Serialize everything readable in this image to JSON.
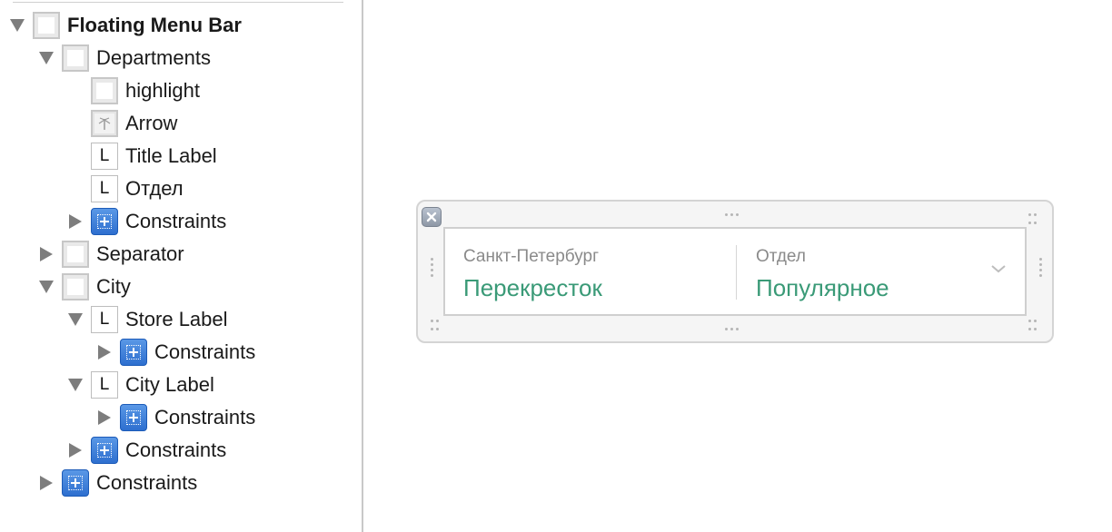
{
  "outline": {
    "rows": [
      {
        "label": "Floating Menu Bar",
        "icon": "view-icon",
        "disclosure": "expanded",
        "level": 0,
        "bold": true
      },
      {
        "label": "Departments",
        "icon": "view-icon",
        "disclosure": "expanded",
        "level": 1,
        "bold": false
      },
      {
        "label": "highlight",
        "icon": "view-icon",
        "disclosure": "none",
        "level": 2,
        "bold": false
      },
      {
        "label": "Arrow",
        "icon": "image-view-icon",
        "disclosure": "none",
        "level": 2,
        "bold": false
      },
      {
        "label": "Title Label",
        "icon": "label-icon",
        "disclosure": "none",
        "level": 2,
        "bold": false
      },
      {
        "label": "Отдел",
        "icon": "label-icon",
        "disclosure": "none",
        "level": 2,
        "bold": false
      },
      {
        "label": "Constraints",
        "icon": "constraints-icon",
        "disclosure": "collapsed",
        "level": 2,
        "bold": false
      },
      {
        "label": "Separator",
        "icon": "view-icon",
        "disclosure": "collapsed",
        "level": 1,
        "bold": false
      },
      {
        "label": "City",
        "icon": "view-icon",
        "disclosure": "expanded",
        "level": 1,
        "bold": false
      },
      {
        "label": "Store Label",
        "icon": "label-icon",
        "disclosure": "expanded",
        "level": 2,
        "bold": false
      },
      {
        "label": "Constraints",
        "icon": "constraints-icon",
        "disclosure": "collapsed",
        "level": 3,
        "bold": false
      },
      {
        "label": "City Label",
        "icon": "label-icon",
        "disclosure": "expanded",
        "level": 2,
        "bold": false
      },
      {
        "label": "Constraints",
        "icon": "constraints-icon",
        "disclosure": "collapsed",
        "level": 3,
        "bold": false
      },
      {
        "label": "Constraints",
        "icon": "constraints-icon",
        "disclosure": "collapsed",
        "level": 2,
        "bold": false
      },
      {
        "label": "Constraints",
        "icon": "constraints-icon",
        "disclosure": "collapsed",
        "level": 1,
        "bold": false
      }
    ],
    "label_icon_glyph": "L"
  },
  "canvas": {
    "menu_bar": {
      "city": {
        "caption": "Санкт-Петербург",
        "value": "Перекресток"
      },
      "department": {
        "caption": "Отдел",
        "value": "Популярное"
      },
      "chevron_icon": "chevron-down-icon"
    },
    "close_icon": "close-icon"
  },
  "colors": {
    "accent_green": "#3a9a77",
    "caption_gray": "#8a8a8a",
    "constraints_blue": "#2e6fcf"
  }
}
